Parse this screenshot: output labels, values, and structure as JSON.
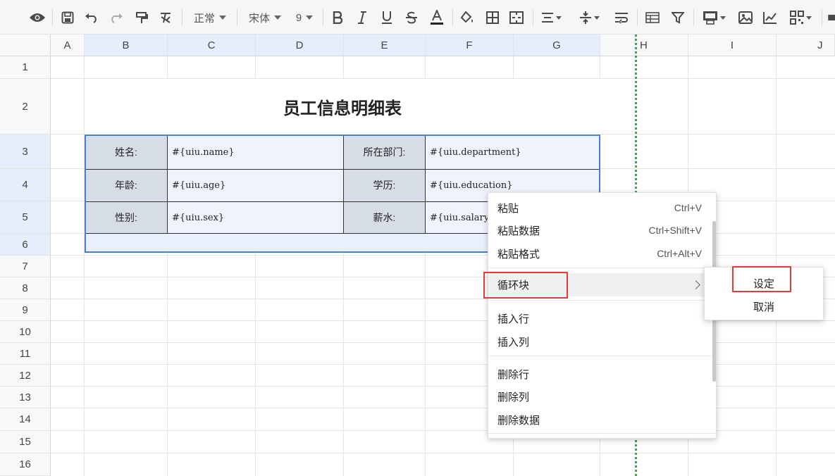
{
  "toolbar": {
    "style_select": "正常",
    "font_select": "宋体",
    "size_select": "9",
    "icons": [
      "eye-icon",
      "save-icon",
      "undo-icon",
      "redo-icon",
      "format-painter-icon",
      "clear-format-icon",
      "bold-icon",
      "italic-icon",
      "underline-icon",
      "strikethrough-icon",
      "font-color-icon",
      "fill-color-icon",
      "borders-icon",
      "merge-cells-icon",
      "align-horizontal-icon",
      "align-vertical-icon",
      "wrap-text-icon",
      "table-icon",
      "filter-icon",
      "print-icon",
      "image-icon",
      "chart-icon",
      "qrcode-icon"
    ],
    "accent_color": "#3ea84a"
  },
  "columns": [
    "A",
    "B",
    "C",
    "D",
    "E",
    "F",
    "G",
    "H",
    "I",
    "J"
  ],
  "rows": [
    "1",
    "2",
    "3",
    "4",
    "5",
    "6",
    "7",
    "8",
    "9",
    "10",
    "11",
    "12",
    "13",
    "14",
    "15",
    "16"
  ],
  "sheet": {
    "title": "员工信息明细表",
    "table": [
      {
        "label1": "姓名:",
        "value1": "#{uiu.name}",
        "label2": "所在部门:",
        "value2": "#{uiu.department}"
      },
      {
        "label1": "年龄:",
        "value1": "#{uiu.age}",
        "label2": "学历:",
        "value2": "#{uiu.education}"
      },
      {
        "label1": "性别:",
        "value1": "#{uiu.sex}",
        "label2": "薪水:",
        "value2": "#{uiu.salary}"
      }
    ]
  },
  "context_menu": {
    "items": [
      {
        "label": "粘贴",
        "shortcut": "Ctrl+V"
      },
      {
        "label": "粘贴数据",
        "shortcut": "Ctrl+Shift+V"
      },
      {
        "label": "粘贴格式",
        "shortcut": "Ctrl+Alt+V"
      },
      {
        "label": "循环块",
        "shortcut": ""
      },
      {
        "label": "插入行",
        "shortcut": ""
      },
      {
        "label": "插入列",
        "shortcut": ""
      },
      {
        "label": "删除行",
        "shortcut": ""
      },
      {
        "label": "删除列",
        "shortcut": ""
      },
      {
        "label": "删除数据",
        "shortcut": ""
      }
    ],
    "submenu": [
      {
        "label": "设定"
      },
      {
        "label": "取消"
      }
    ],
    "highlight_color": "#e03c3c"
  }
}
